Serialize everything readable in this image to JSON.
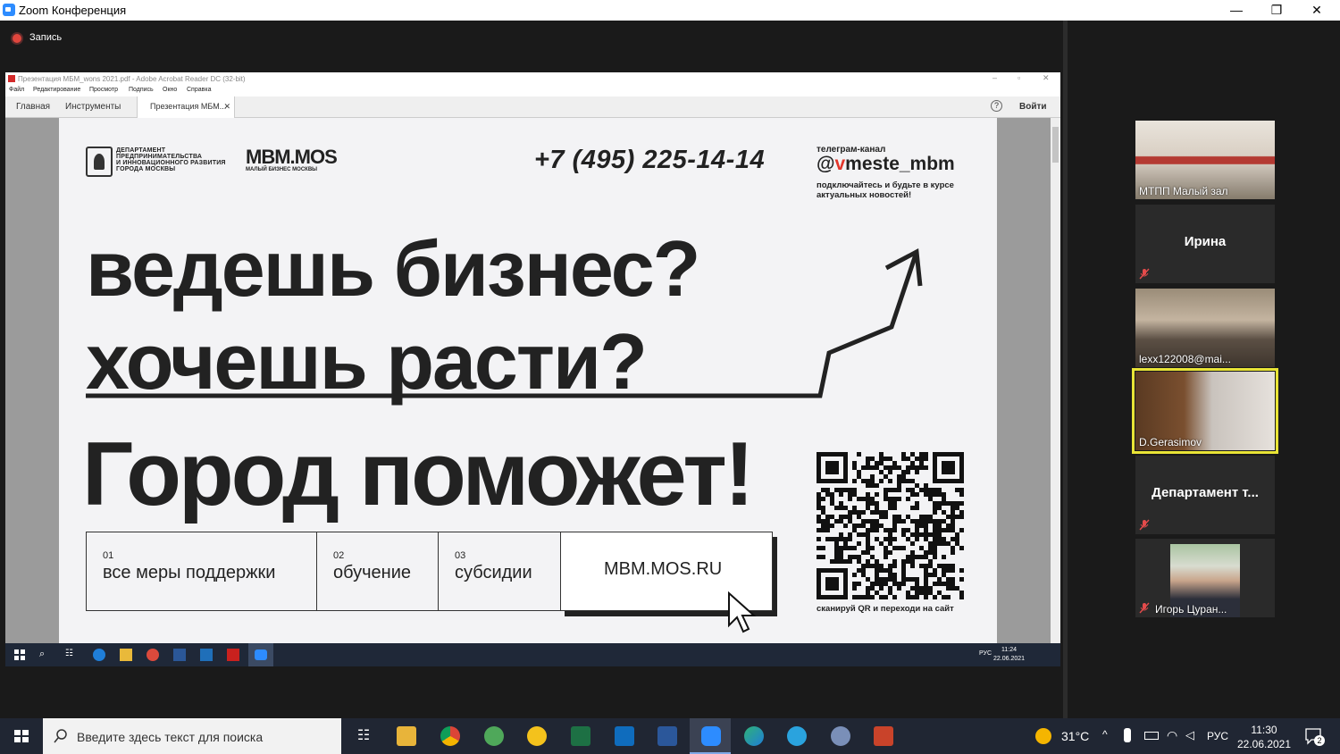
{
  "zoom": {
    "window_title": "Zoom Конференция",
    "recording_label": "Запись",
    "min_glyph": "—",
    "restore_glyph": "❐",
    "close_glyph": "✕"
  },
  "acrobat": {
    "title": "Презентация МБМ_wons 2021.pdf - Adobe Acrobat Reader DC (32-bit)",
    "menu": [
      "Файл",
      "Редактирование",
      "Просмотр",
      "Подпись",
      "Окно",
      "Справка"
    ],
    "tabs": {
      "home": "Главная",
      "tools": "Инструменты",
      "doc": "Презентация МБМ...",
      "signin": "Войти"
    }
  },
  "slide": {
    "dept_name": "ДЕПАРТАМЕНТ\nПРЕДПРИНИМАТЕЛЬСТВА\nИ ИННОВАЦИОННОГО РАЗВИТИЯ\nГОРОДА МОСКВЫ",
    "mbm_logo": "MBM.MOS",
    "mbm_sub": "МАЛЫЙ БИЗНЕС МОСКВЫ",
    "phone": "+7 (495) 225-14-14",
    "telegram_label": "телеграм-канал",
    "telegram_at": "@",
    "telegram_v": "v",
    "telegram_rest": "meste_mbm",
    "telegram_desc": "подключайтесь и будьте в курсе\nактуальных новостей!",
    "headline_1": "ведешь бизнес?",
    "headline_2": "хочешь расти?",
    "headline_3": "Город поможет!",
    "boxes": [
      {
        "num": "01",
        "label": "все меры поддержки"
      },
      {
        "num": "02",
        "label": "обучение"
      },
      {
        "num": "03",
        "label": "субсидии"
      }
    ],
    "site": "MBM.MOS.RU",
    "qr_caption": "сканируй QR и переходи на сайт"
  },
  "inner_taskbar": {
    "time": "11:24",
    "date": "22.06.2021",
    "lang": "РУС"
  },
  "participants": [
    {
      "name": "МТПП Малый зал",
      "video": true
    },
    {
      "name": "Ирина",
      "video": false,
      "muted": true
    },
    {
      "name": "lexx122008@mai...",
      "video": true
    },
    {
      "name": "D.Gerasimov",
      "video": true,
      "active": true
    },
    {
      "name": "Департамент т...",
      "video": false,
      "muted": true
    },
    {
      "name": "Игорь Цуран...",
      "video": true,
      "muted": true
    }
  ],
  "taskbar": {
    "search_placeholder": "Введите здесь текст для поиска",
    "temperature": "31°C",
    "lang": "РУС",
    "time": "11:30",
    "date": "22.06.2021",
    "notifications": "2"
  }
}
